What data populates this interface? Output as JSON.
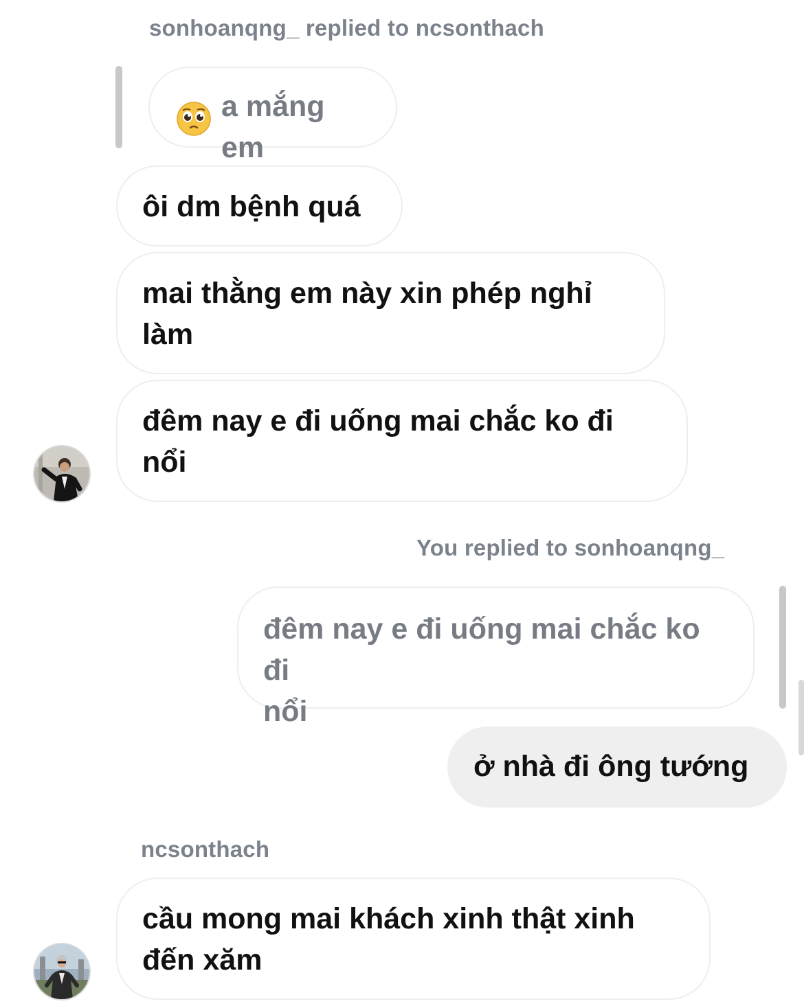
{
  "thread": {
    "reply_header_1": "sonhoanqng_ replied to ncsonthach",
    "quoted_1": {
      "emoji_icon": "pleading-face-icon",
      "text": "a mắng em"
    },
    "incoming_group_1": [
      {
        "lines": [
          "ôi dm bệnh quá"
        ]
      },
      {
        "lines": [
          "mai thằng em này xin phép nghỉ",
          "làm"
        ]
      },
      {
        "lines": [
          "đêm nay e đi uống mai chắc ko đi",
          "nổi"
        ]
      }
    ],
    "reply_header_2": "You replied to sonhoanqng_",
    "quoted_2": {
      "lines": [
        "đêm nay e đi uống mai chắc ko đi",
        "nổi"
      ]
    },
    "outgoing_1": "ở nhà đi ông tướng",
    "sender_name_2": "ncsonthach",
    "incoming_group_2": [
      {
        "lines": [
          "cầu mong mai khách xinh thật xinh",
          "đến xăm"
        ]
      }
    ]
  },
  "colors": {
    "meta_text": "#7b828c",
    "bubble_border": "#eceef0",
    "quote_bar": "#c7c8ca",
    "outgoing_bg": "#efefef"
  }
}
